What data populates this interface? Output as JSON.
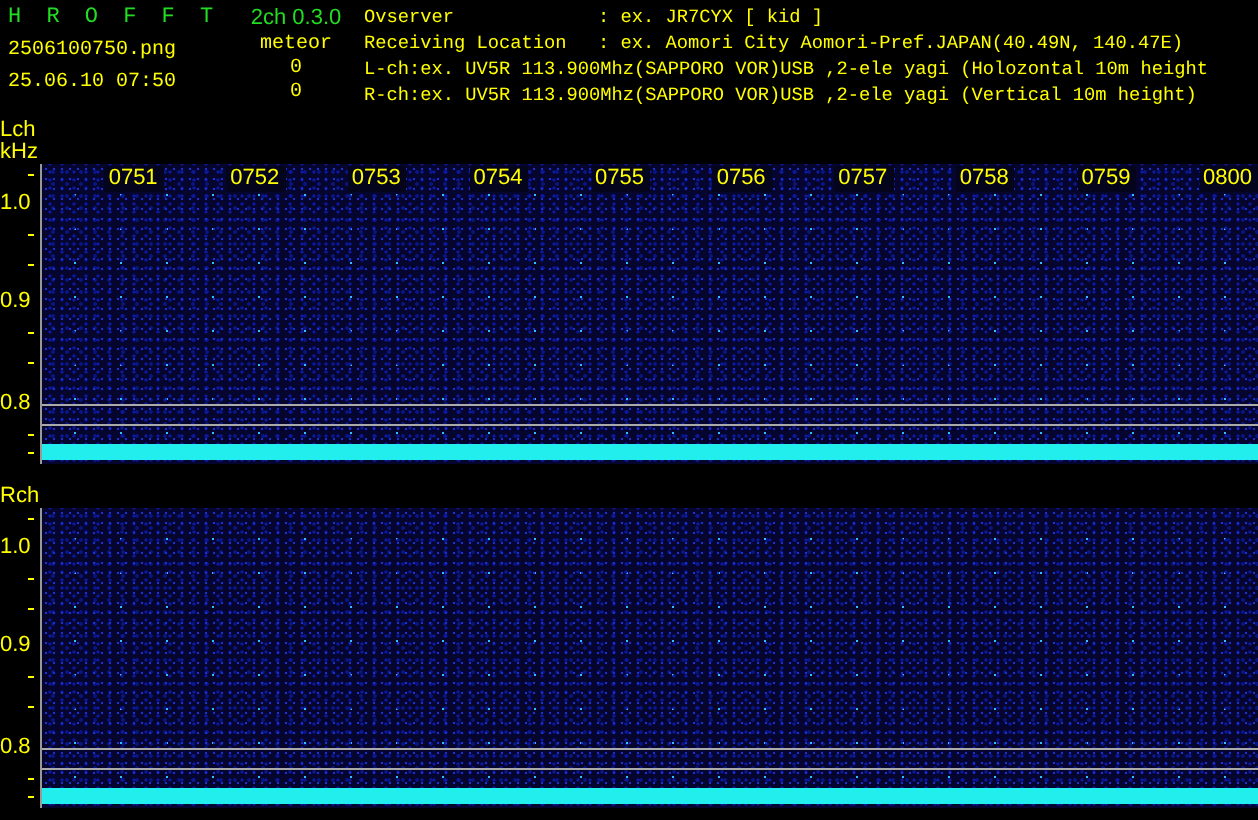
{
  "header": {
    "app_name": "H R O F F T",
    "version": "2ch 0.3.0",
    "filename": "2506100750.png",
    "datetime": "25.06.10 07:50",
    "meteor_label": "meteor",
    "meteor_counts": [
      "0",
      "0"
    ]
  },
  "fields": [
    {
      "label": "Ovserver",
      "value": ": ex. JR7CYX [ kid ]"
    },
    {
      "label": "Receiving Location",
      "value": ": ex. Aomori City Aomori-Pref.JAPAN(40.49N, 140.47E)"
    }
  ],
  "channel_notes": [
    "L-ch:ex. UV5R 113.900Mhz(SAPPORO VOR)USB ,2-ele yagi (Holozontal 10m height",
    "R-ch:ex. UV5R 113.900Mhz(SAPPORO VOR)USB ,2-ele yagi (Vertical 10m height)"
  ],
  "channels": [
    {
      "name": "Lch",
      "unit": "kHz",
      "time_labels": [
        "0751",
        "0752",
        "0753",
        "0754",
        "0755",
        "0756",
        "0757",
        "0758",
        "0759",
        "0800"
      ],
      "y_labels": [
        "1.0",
        "0.9",
        "0.8"
      ]
    },
    {
      "name": "Rch",
      "y_labels": [
        "1.0",
        "0.9",
        "0.8"
      ]
    }
  ]
}
